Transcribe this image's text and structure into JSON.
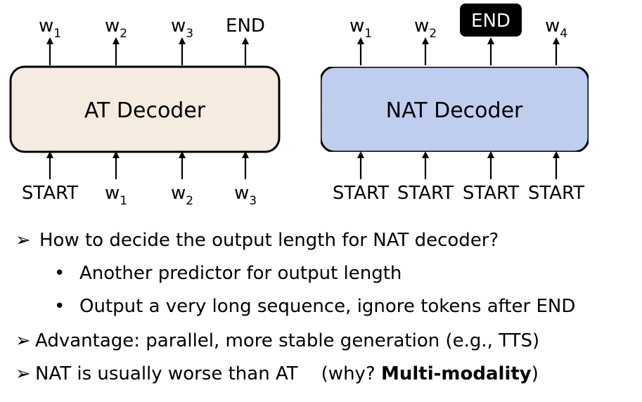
{
  "at_decoder": {
    "label": "AT Decoder",
    "inputs": [
      {
        "base": "START",
        "sub": ""
      },
      {
        "base": "w",
        "sub": "1"
      },
      {
        "base": "w",
        "sub": "2"
      },
      {
        "base": "w",
        "sub": "3"
      }
    ],
    "outputs": [
      {
        "base": "w",
        "sub": "1"
      },
      {
        "base": "w",
        "sub": "2"
      },
      {
        "base": "w",
        "sub": "3"
      },
      {
        "base": "END",
        "sub": ""
      }
    ]
  },
  "nat_decoder": {
    "label": "NAT Decoder",
    "inputs": [
      {
        "base": "START",
        "sub": ""
      },
      {
        "base": "START",
        "sub": ""
      },
      {
        "base": "START",
        "sub": ""
      },
      {
        "base": "START",
        "sub": ""
      }
    ],
    "outputs": [
      {
        "base": "w",
        "sub": "1"
      },
      {
        "base": "w",
        "sub": "2"
      },
      {
        "base": "END",
        "sub": "",
        "highlight": true
      },
      {
        "base": "w",
        "sub": "4"
      }
    ]
  },
  "colors": {
    "at_fill": "#f6ebe1",
    "nat_fill": "#c7d3ef",
    "end_badge": "#000000",
    "arrow": "#000000"
  },
  "bullets": {
    "b1_marker": "➢",
    "b1_text": "How to decide the output length for NAT decoder?",
    "b1a_marker": "•",
    "b1a_text": "Another predictor for output length",
    "b1b_marker": "•",
    "b1b_text": "Output a very long sequence, ignore tokens after END",
    "b2_marker": "➢",
    "b2_text": "Advantage: parallel, more stable generation (e.g., TTS)",
    "b3_marker": "➢",
    "b3_text_prefix": "NAT is usually worse than AT    (why? ",
    "b3_text_bold": "Multi-modality",
    "b3_text_suffix": ")"
  }
}
